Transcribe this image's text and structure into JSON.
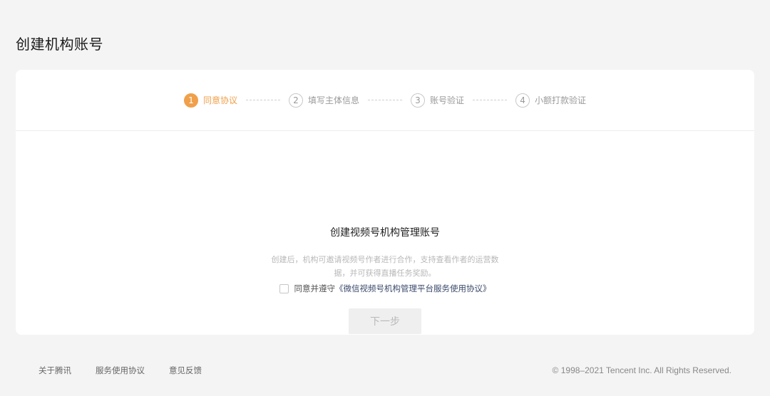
{
  "page_title": "创建机构账号",
  "steps": [
    {
      "num": "1",
      "label": "同意协议",
      "active": true
    },
    {
      "num": "2",
      "label": "填写主体信息",
      "active": false
    },
    {
      "num": "3",
      "label": "账号验证",
      "active": false
    },
    {
      "num": "4",
      "label": "小额打款验证",
      "active": false
    }
  ],
  "main": {
    "title": "创建视频号机构管理账号",
    "desc_line1": "创建后，机构可邀请视频号作者进行合作，支持查看作者的运营数",
    "desc_line2": "据，并可获得直播任务奖励。",
    "agree_text": "同意并遵守",
    "agree_link": "《微信视频号机构管理平台服务使用协议》",
    "next_button": "下一步"
  },
  "footer": {
    "links": [
      "关于腾讯",
      "服务使用协议",
      "意见反馈"
    ],
    "copyright": "© 1998–2021 Tencent Inc. All Rights Reserved."
  },
  "colors": {
    "accent": "#f0a04a",
    "background": "#f4f4f4",
    "card": "#ffffff",
    "link": "#3a4a6b"
  }
}
